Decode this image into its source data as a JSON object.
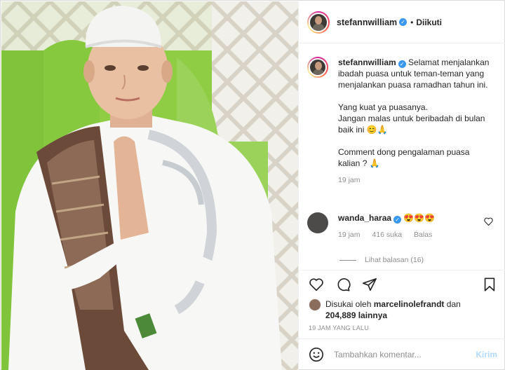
{
  "post": {
    "username": "stefannwilliam",
    "follow_status": "Diikuti",
    "caption": "Selamat menjalankan ibadah puasa untuk teman-teman yang menjalankan puasa ramadhan tahun ini.\n\nYang kuat ya puasanya.\nJangan malas untuk beribadah di bulan baik ini 😊🙏\n\nComment dong pengalaman puasa kalian ? 🙏",
    "caption_time": "19 jam"
  },
  "comment": {
    "username": "wanda_haraa",
    "text": "😍😍😍",
    "time": "19 jam",
    "likes": "416 suka",
    "reply_label": "Balas",
    "view_replies": "Lihat balasan (16)"
  },
  "likes": {
    "prefix": "Disukai oleh",
    "user": "marcelinolefrandt",
    "joiner": "dan",
    "count": "204,889 lainnya"
  },
  "timestamp": "19 JAM YANG LALU",
  "comment_box": {
    "placeholder": "Tambahkan komentar...",
    "post_label": "Kirim"
  },
  "icons": {
    "verified": "verified-badge-icon",
    "like": "heart-icon",
    "comment": "comment-icon",
    "share": "paper-plane-icon",
    "save": "bookmark-icon",
    "emoji": "smiley-icon"
  },
  "colors": {
    "verified": "#3897f0",
    "post_button": "#b3dbff",
    "muted": "#8e8e8e"
  }
}
